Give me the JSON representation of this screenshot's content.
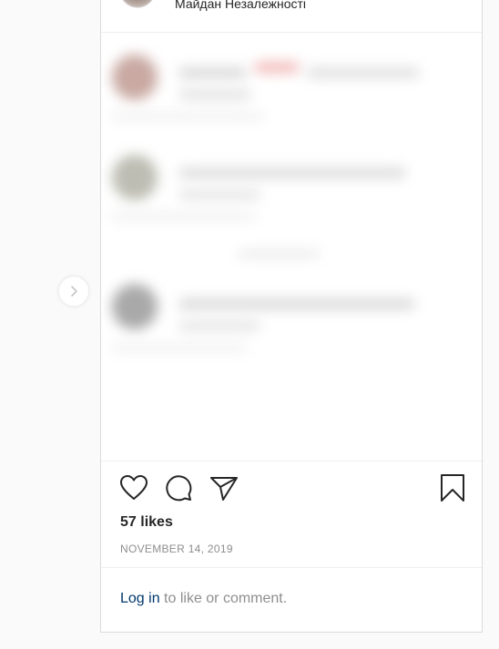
{
  "post": {
    "location": "Майдан Незалежності",
    "likes_count": "57",
    "likes_suffix": "likes",
    "date": "NOVEMBER 14, 2019"
  },
  "actions": {
    "like_icon": "heart-icon",
    "comment_icon": "comment-icon",
    "share_icon": "share-icon",
    "save_icon": "bookmark-icon"
  },
  "login_prompt": {
    "link_text": "Log in",
    "rest_text": " to like or comment."
  },
  "colors": {
    "link": "#00376b",
    "muted": "#8e8e8e",
    "text": "#262626",
    "border": "#dbdbdb"
  }
}
